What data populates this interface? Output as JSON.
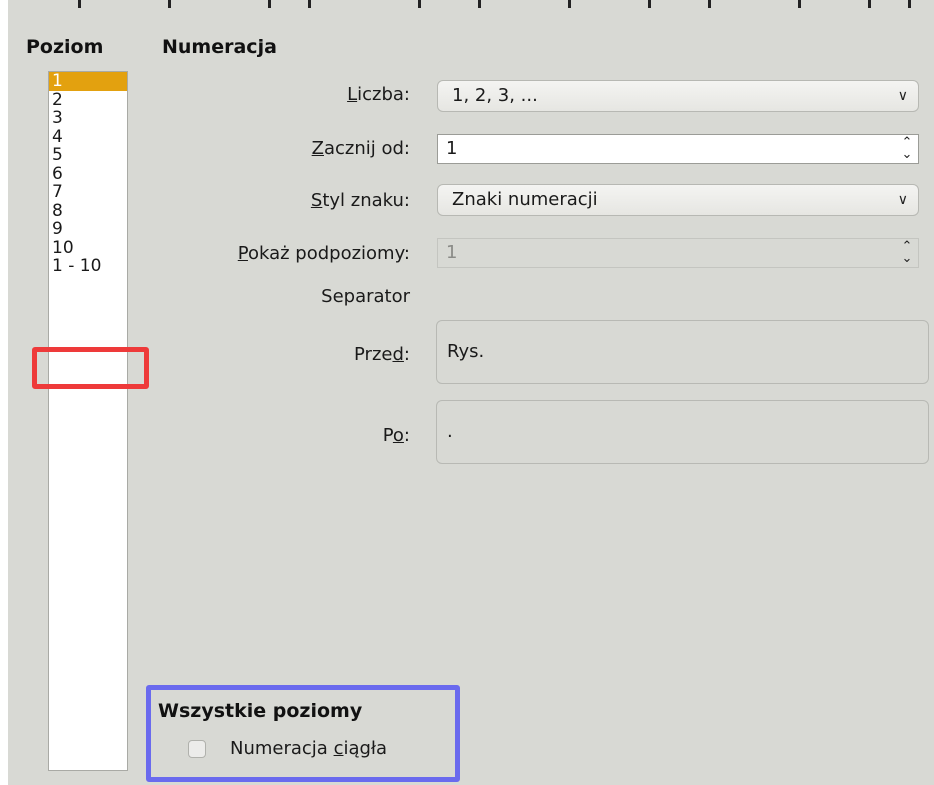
{
  "level_panel": {
    "heading": "Poziom",
    "levels": [
      "1",
      "2",
      "3",
      "4",
      "5",
      "6",
      "7",
      "8",
      "9",
      "10",
      "1 - 10"
    ],
    "selected": "1"
  },
  "numbering": {
    "heading": "Numeracja",
    "number_label": {
      "mnemonic": "L",
      "rest": "iczba:"
    },
    "number_value": "1, 2, 3, ...",
    "start_label": {
      "mnemonic": "Z",
      "rest": "acznij od:"
    },
    "start_value": "1",
    "char_style_label": {
      "mnemonic": "S",
      "rest": "tyl znaku:"
    },
    "char_style_value": "Znaki numeracji",
    "sublevels_label": {
      "mnemonic": "P",
      "rest": "okaż podpoziomy:"
    },
    "sublevels_value": "1",
    "separator_label": "Separator",
    "before_label": {
      "pre": "Prze",
      "mnemonic": "d",
      "post": ":"
    },
    "before_value": "Rys.",
    "after_label": {
      "pre": "P",
      "mnemonic": "o",
      "post": ":"
    },
    "after_value": "."
  },
  "all_levels": {
    "heading": "Wszystkie poziomy",
    "consecutive_label": {
      "pre": "Numeracja ",
      "mnemonic": "c",
      "post": "iągła"
    },
    "consecutive_checked": false
  },
  "highlight_colors": {
    "red": "#ee3a3a",
    "blue": "#6a6aee",
    "selection": "#e3a10f"
  }
}
